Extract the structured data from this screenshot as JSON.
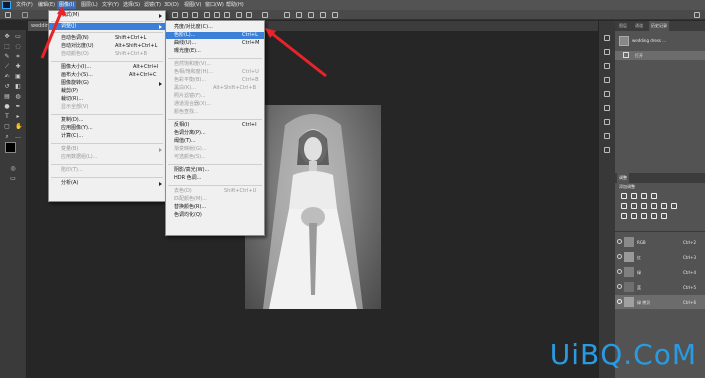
{
  "menubar": {
    "items": [
      "文件(F)",
      "编辑(E)",
      "图像(I)",
      "图层(L)",
      "文字(Y)",
      "选择(S)",
      "滤镜(T)",
      "3D(D)",
      "视图(V)",
      "窗口(W)",
      "帮助(H)"
    ]
  },
  "document_tab": "wedding dress ...",
  "image_menu": {
    "items": [
      {
        "label": "模式(M)",
        "shortcut": "",
        "submenu": true
      },
      {
        "label": "调整(J)",
        "shortcut": "",
        "submenu": true
      },
      {
        "label": "自动色调(N)",
        "shortcut": "Shift+Ctrl+L"
      },
      {
        "label": "自动对比度(U)",
        "shortcut": "Alt+Shift+Ctrl+L"
      },
      {
        "label": "自动颜色(O)",
        "shortcut": "Shift+Ctrl+B"
      },
      {
        "label": "图像大小(I)...",
        "shortcut": "Alt+Ctrl+I"
      },
      {
        "label": "画布大小(S)...",
        "shortcut": "Alt+Ctrl+C"
      },
      {
        "label": "图像旋转(G)",
        "shortcut": "",
        "submenu": true
      },
      {
        "label": "裁剪(P)",
        "shortcut": ""
      },
      {
        "label": "裁切(R)...",
        "shortcut": ""
      },
      {
        "label": "显示全部(V)",
        "shortcut": ""
      },
      {
        "label": "复制(D)...",
        "shortcut": ""
      },
      {
        "label": "应用图像(Y)...",
        "shortcut": ""
      },
      {
        "label": "计算(C)...",
        "shortcut": ""
      },
      {
        "label": "变量(B)",
        "shortcut": "",
        "submenu": true
      },
      {
        "label": "应用数据组(L)...",
        "shortcut": ""
      },
      {
        "label": "陷印(T)...",
        "shortcut": ""
      },
      {
        "label": "分析(A)",
        "shortcut": "",
        "submenu": true
      }
    ]
  },
  "adjust_menu": {
    "items": [
      {
        "label": "亮度/对比度(C)...",
        "shortcut": ""
      },
      {
        "label": "色阶(L)...",
        "shortcut": "Ctrl+L"
      },
      {
        "label": "曲线(U)...",
        "shortcut": "Ctrl+M"
      },
      {
        "label": "曝光度(E)...",
        "shortcut": ""
      },
      {
        "label": "自然饱和度(V)...",
        "shortcut": ""
      },
      {
        "label": "色相/饱和度(H)...",
        "shortcut": "Ctrl+U"
      },
      {
        "label": "色彩平衡(B)...",
        "shortcut": "Ctrl+B"
      },
      {
        "label": "黑白(K)...",
        "shortcut": "Alt+Shift+Ctrl+B"
      },
      {
        "label": "照片滤镜(F)...",
        "shortcut": ""
      },
      {
        "label": "通道混合器(X)...",
        "shortcut": ""
      },
      {
        "label": "颜色查找...",
        "shortcut": ""
      },
      {
        "label": "反相(I)",
        "shortcut": "Ctrl+I"
      },
      {
        "label": "色调分离(P)...",
        "shortcut": ""
      },
      {
        "label": "阈值(T)...",
        "shortcut": ""
      },
      {
        "label": "渐变映射(G)...",
        "shortcut": ""
      },
      {
        "label": "可选颜色(S)...",
        "shortcut": ""
      },
      {
        "label": "阴影/高光(W)...",
        "shortcut": ""
      },
      {
        "label": "HDR 色调...",
        "shortcut": ""
      },
      {
        "label": "去色(D)",
        "shortcut": "Shift+Ctrl+U"
      },
      {
        "label": "匹配颜色(M)...",
        "shortcut": ""
      },
      {
        "label": "替换颜色(R)...",
        "shortcut": ""
      },
      {
        "label": "色调均化(Q)",
        "shortcut": ""
      }
    ]
  },
  "right_panels": {
    "top_tabs": [
      "图层",
      "通道",
      "历史记录"
    ],
    "history_doc": "wedding dress ...",
    "history_item": "打开",
    "adjust_title": "调整",
    "adjust_sub": "添加调整",
    "channels": [
      {
        "name": "RGB",
        "shortcut": "Ctrl+2"
      },
      {
        "name": "红",
        "shortcut": "Ctrl+3"
      },
      {
        "name": "绿",
        "shortcut": "Ctrl+4"
      },
      {
        "name": "蓝",
        "shortcut": "Ctrl+5"
      },
      {
        "name": "绿 拷贝",
        "shortcut": "Ctrl+6"
      }
    ]
  },
  "watermark": "UiBQ.CoM",
  "colors": {
    "accent": "#3c7fd6",
    "arrow": "#e8242a",
    "watermark": "#2a9be0"
  }
}
